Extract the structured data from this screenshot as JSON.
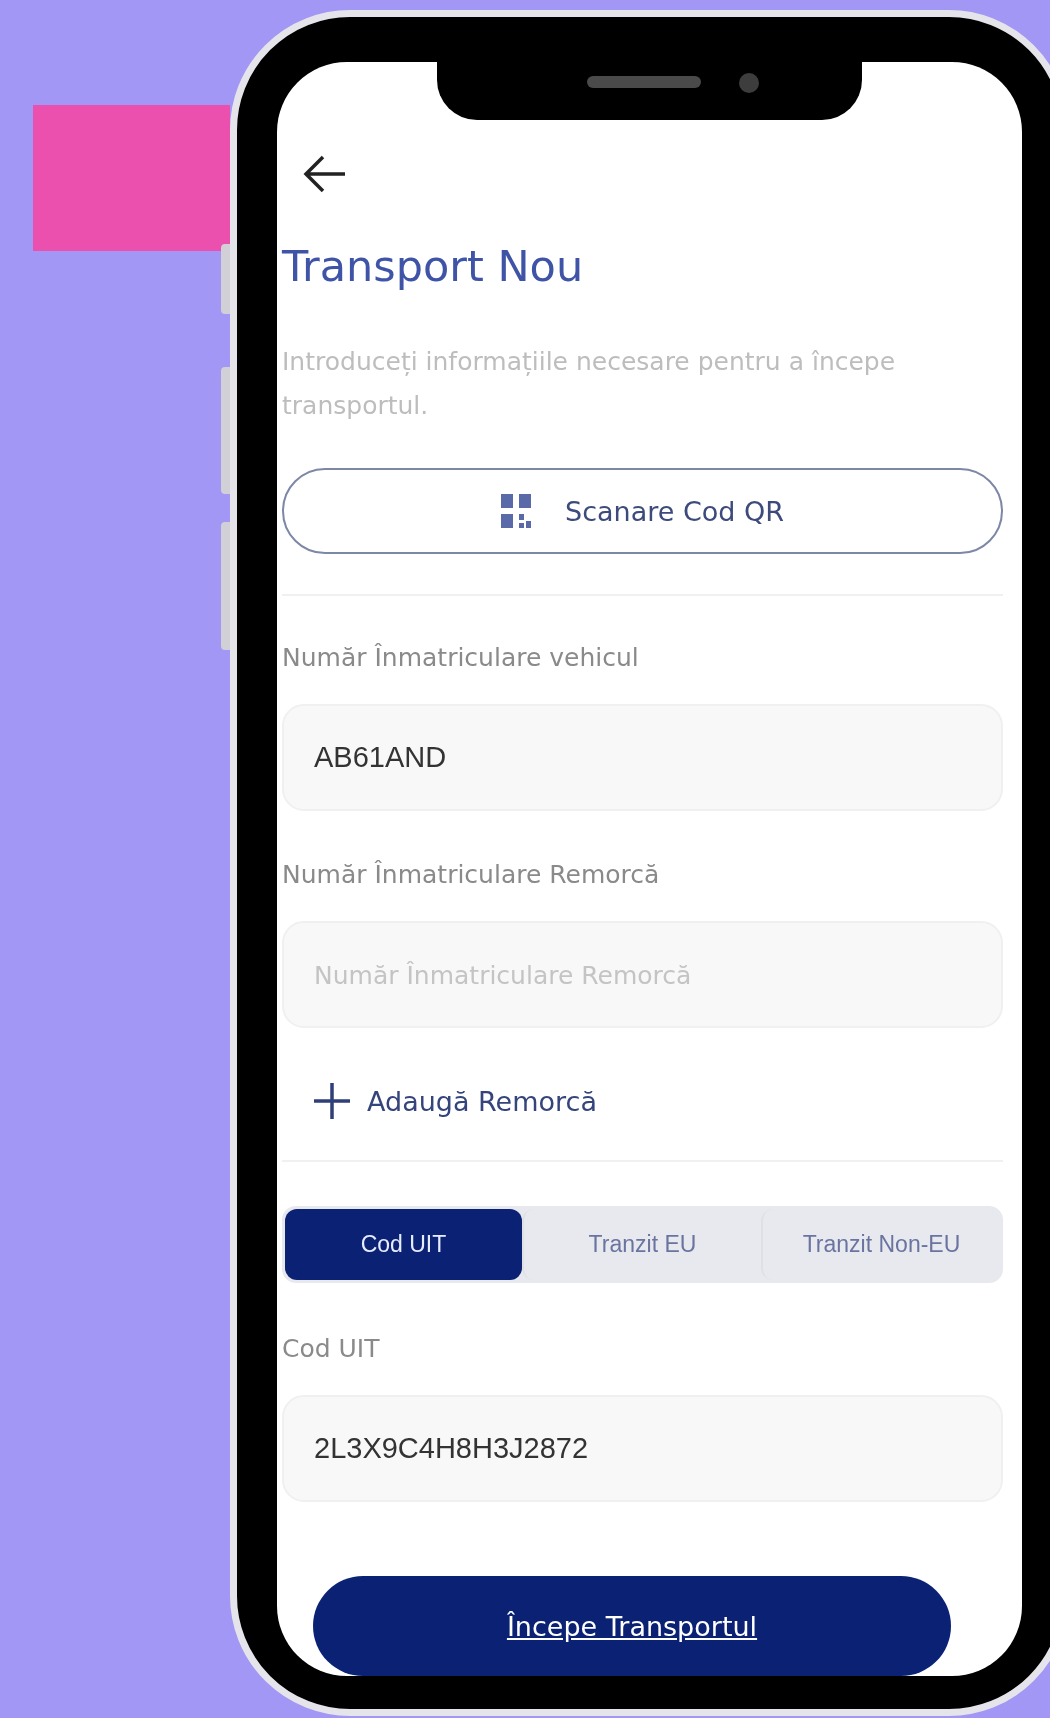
{
  "header": {
    "title": "Transport Nou",
    "description": "Introduceți informațiile necesare pentru a începe transportul."
  },
  "scan_button": {
    "label": "Scanare Cod QR"
  },
  "fields": [
    {
      "label": "Număr Înmatriculare vehicul",
      "value": "AB61AND"
    },
    {
      "label": "Număr Înmatriculare Remorcă",
      "placeholder": "Număr Înmatriculare Remorcă"
    }
  ],
  "add_trailer": {
    "label": "Adaugă Remorcă"
  },
  "tabs": [
    {
      "label": "Cod UIT",
      "selected": true
    },
    {
      "label": "Tranzit EU",
      "selected": false
    },
    {
      "label": "Tranzit Non-EU",
      "selected": false
    }
  ],
  "code_field": {
    "label": "Cod UIT",
    "value": "2L3X9C4H8H3J2872"
  },
  "primary_button": {
    "label": "Începe Transportul"
  }
}
